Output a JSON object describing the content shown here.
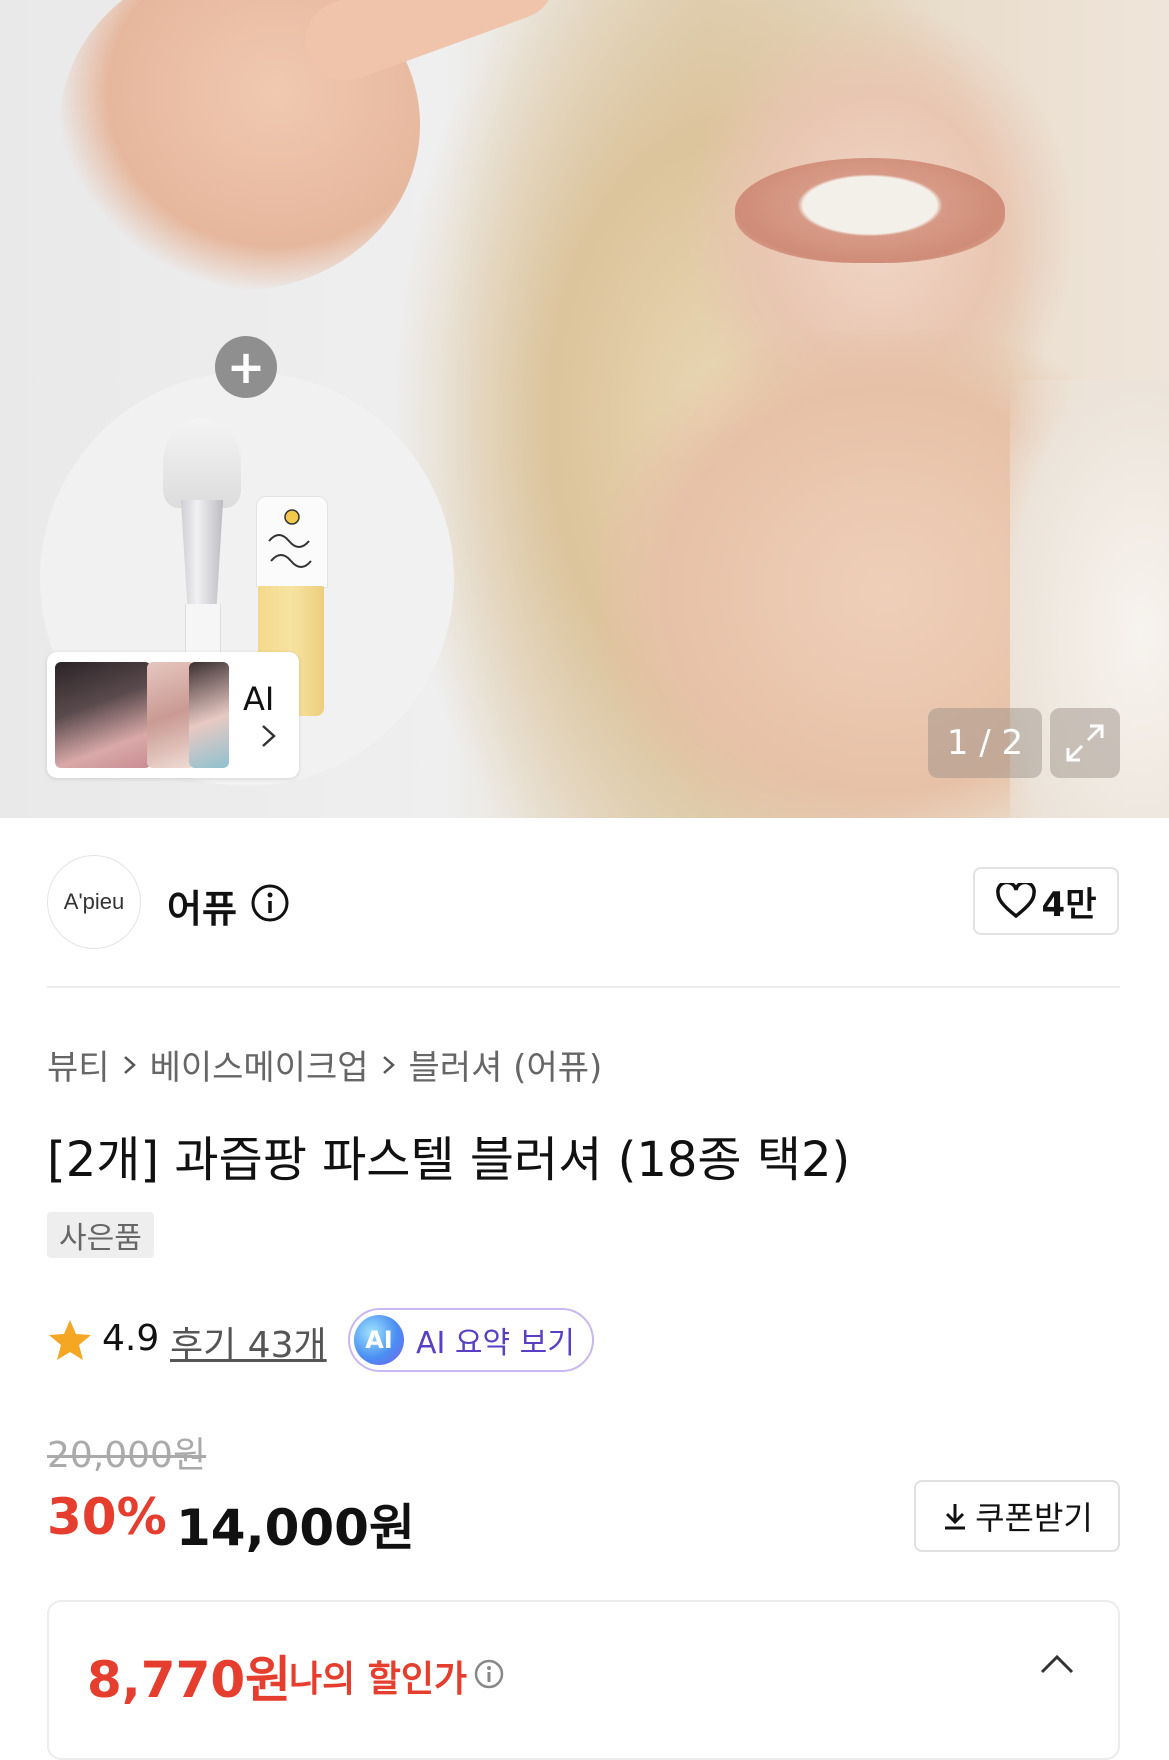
{
  "hero": {
    "counter": "1 / 2",
    "ai_label": "AI",
    "plus_label": "+"
  },
  "brand": {
    "logo_text": "A'pieu",
    "name": "어퓨",
    "likes": "4만"
  },
  "breadcrumb": [
    "뷰티",
    "베이스메이크업",
    "블러셔 (어퓨)"
  ],
  "product": {
    "title": "[2개] 과즙팡 파스텔 블러셔 (18종 택2)",
    "tag": "사은품"
  },
  "rating": {
    "score": "4.9",
    "reviews": "후기 43개",
    "ai_badge": "AI",
    "ai_summary": "AI 요약 보기"
  },
  "price": {
    "original": "20,000원",
    "discount": "30%",
    "sale": "14,000원",
    "coupon": "쿠폰받기"
  },
  "my_price": {
    "value": "8,770원",
    "label": "나의 할인가"
  },
  "colors": {
    "accent_red": "#e53e2f",
    "ai_purple": "#5a3fc4",
    "star": "#f5a623"
  },
  "icons": [
    "plus-icon",
    "chevron-right-icon",
    "expand-icon",
    "info-icon",
    "heart-icon",
    "star-icon",
    "download-icon",
    "chevron-up-icon"
  ]
}
